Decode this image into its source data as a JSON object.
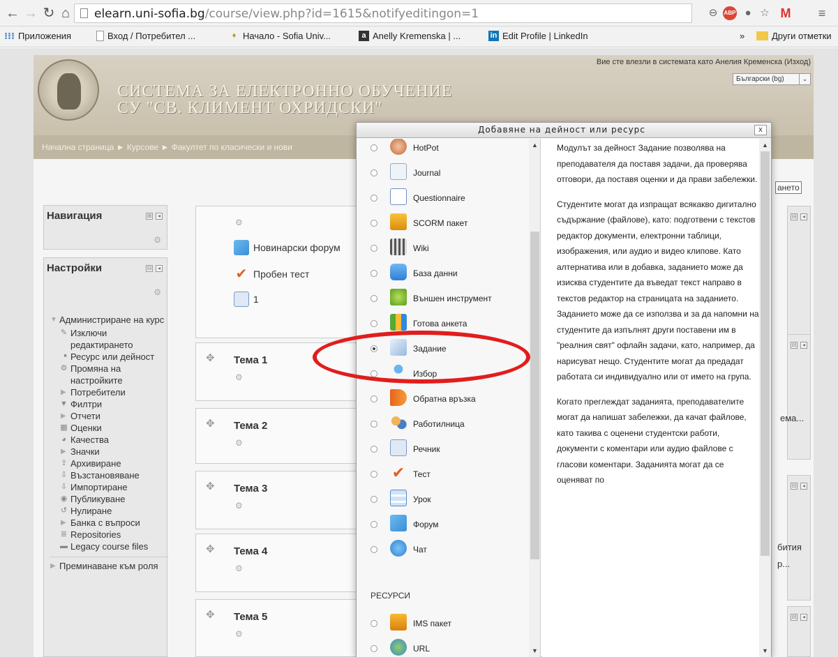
{
  "browser": {
    "url_host": "elearn.uni-sofia.bg",
    "url_path": "/course/view.php?id=1615&notifyeditingon=1",
    "bookmarks": [
      {
        "label": "Приложения"
      },
      {
        "label": "Вход / Потребител ..."
      },
      {
        "label": "Начало - Sofia Univ..."
      },
      {
        "label": "Anelly Kremenska | ..."
      },
      {
        "label": "Edit Profile | LinkedIn"
      }
    ],
    "more_bookmarks": "»",
    "other_bookmarks": "Други отметки"
  },
  "header": {
    "site_title_line1": "СИСТЕМА ЗА ЕЛЕКТРОННО ОБУЧЕНИЕ",
    "site_title_line2": "СУ \"СВ. КЛИМЕНТ ОХРИДСКИ\"",
    "login_info": "Вие сте влезли в системата като Анелия Кременска (Изход)",
    "language": "Български (bg)",
    "breadcrumb": "Начална страница ► Курсове ► Факултет по класически и нови",
    "edit_button": "ането"
  },
  "navigation_block": {
    "title": "Навигация"
  },
  "settings_block": {
    "title": "Настройки",
    "items": [
      {
        "label": "Администриране на курс"
      },
      {
        "label": "Изключи редактирането"
      },
      {
        "label": "Ресурс или дейност"
      },
      {
        "label": "Промяна на настройките"
      },
      {
        "label": "Потребители"
      },
      {
        "label": "Филтри"
      },
      {
        "label": "Отчети"
      },
      {
        "label": "Оценки"
      },
      {
        "label": "Качества"
      },
      {
        "label": "Значки"
      },
      {
        "label": "Архивиране"
      },
      {
        "label": "Възстановяване"
      },
      {
        "label": "Импортиране"
      },
      {
        "label": "Публикуване"
      },
      {
        "label": "Нулиране"
      },
      {
        "label": "Банка с въпроси"
      },
      {
        "label": "Repositories"
      },
      {
        "label": "Legacy course files"
      },
      {
        "label": "Преминаване към роля"
      }
    ]
  },
  "course": {
    "top_activities": [
      {
        "label": "Новинарски форум"
      },
      {
        "label": "Пробен тест"
      },
      {
        "label": "1"
      }
    ],
    "topics": [
      {
        "label": "Тема 1"
      },
      {
        "label": "Тема 2"
      },
      {
        "label": "Тема 3"
      },
      {
        "label": "Тема 4"
      },
      {
        "label": "Тема 5"
      }
    ]
  },
  "right_column": {
    "text1": "ема...",
    "text2": "бития",
    "text3": "р..."
  },
  "modal": {
    "title": "Добавяне на дейност или ресурс",
    "close": "x",
    "options": [
      {
        "label": "HotPot"
      },
      {
        "label": "Journal"
      },
      {
        "label": "Questionnaire"
      },
      {
        "label": "SCORM пакет"
      },
      {
        "label": "Wiki"
      },
      {
        "label": "База данни"
      },
      {
        "label": "Външен инструмент"
      },
      {
        "label": "Готова анкета"
      },
      {
        "label": "Задание"
      },
      {
        "label": "Избор"
      },
      {
        "label": "Обратна връзка"
      },
      {
        "label": "Работилница"
      },
      {
        "label": "Речник"
      },
      {
        "label": "Тест"
      },
      {
        "label": "Урок"
      },
      {
        "label": "Форум"
      },
      {
        "label": "Чат"
      }
    ],
    "resources_label": "РЕСУРСИ",
    "resources": [
      {
        "label": "IMS пакет"
      },
      {
        "label": "URL"
      }
    ],
    "selected_option": "Задание",
    "help_paragraphs": [
      "Модулът за дейност Задание позволява на преподавателя да поставя задачи, да проверява отговори, да поставя оценки и да прави забележки.",
      "Студентите могат да изпращат всякакво дигитално съдържание (файлове), като: подготвени с текстов редактор документи, електронни таблици, изображения, или аудио и видео клипове. Като алтернатива или в добавка, заданието може да изисква студентите да въведат текст направо в текстов редактор на страницата на заданието. Заданието може да се използва и за да напомни на студентите да изпълнят други поставени им в \"реалния свят\" офлайн задачи, като, например, да нарисуват нещо. Студентите могат да предадат работата си индивидуално или от името на група.",
      "Когато преглеждат заданията, преподавателите могат да напишат забележки, да качат файлове, като такива с оценени студентски работи, документи с коментари или аудио файлове с гласови коментари. Заданията могат да се оценяват по"
    ]
  },
  "colors": {
    "accent_red": "#e21d1d",
    "banner": "#c9c0ad",
    "breadcrumb_bar": "#bfb6a1"
  }
}
